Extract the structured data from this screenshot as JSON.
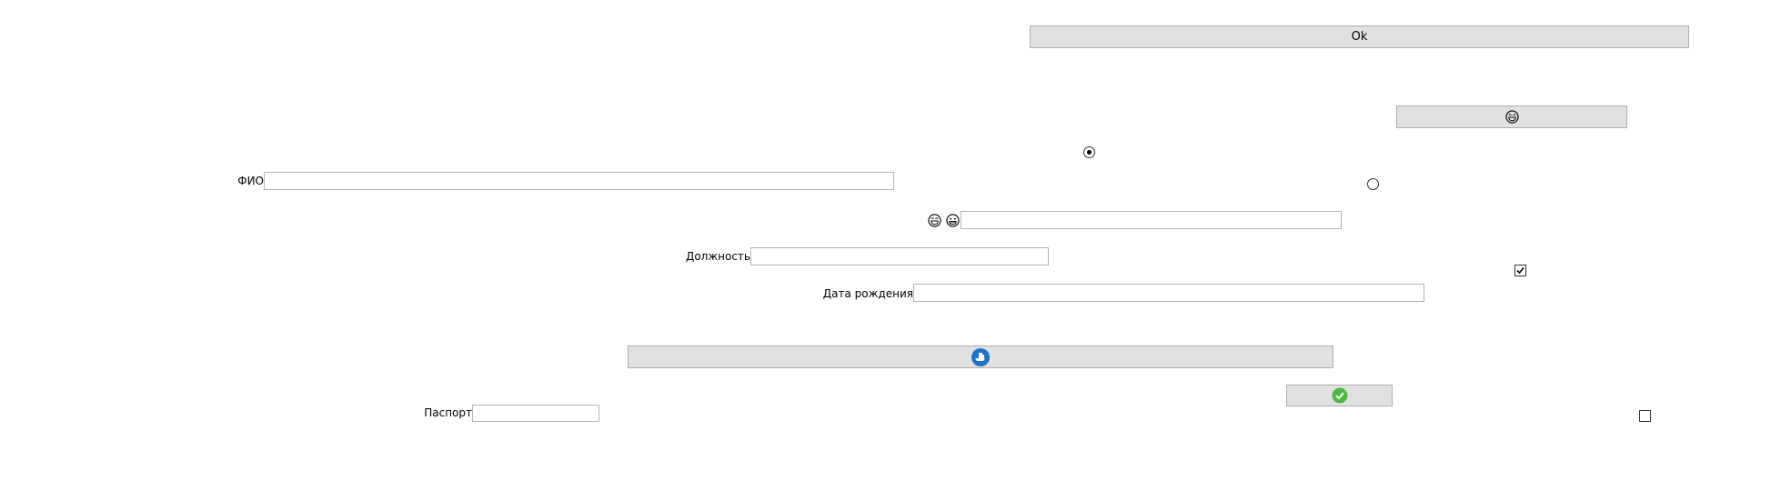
{
  "buttons": {
    "ok_label": "Ok"
  },
  "labels": {
    "fio": "ФИО",
    "position": "Должность",
    "birth_date": "Дата рождения",
    "passport": "Паспорт"
  },
  "fields": {
    "fio_value": "",
    "emoji_value": "",
    "position_value": "",
    "birth_date_value": "",
    "passport_value": ""
  },
  "controls": {
    "radio_1_checked": true,
    "radio_2_checked": false,
    "checkbox_1_checked": true,
    "checkbox_2_checked": false
  },
  "icons": {
    "emoji_button_icon": "laughing-face-icon",
    "emoji_label_1": "laughing-face-icon",
    "emoji_label_2": "grinning-face-icon",
    "ship_button_icon": "ship-globe-icon",
    "confirm_button_icon": "green-check-icon"
  },
  "colors": {
    "button_bg": "#e1e1e1",
    "button_border": "#adadad",
    "field_border": "#b4b4b4",
    "check_green": "#4cb944",
    "globe_blue": "#1e73c8"
  }
}
